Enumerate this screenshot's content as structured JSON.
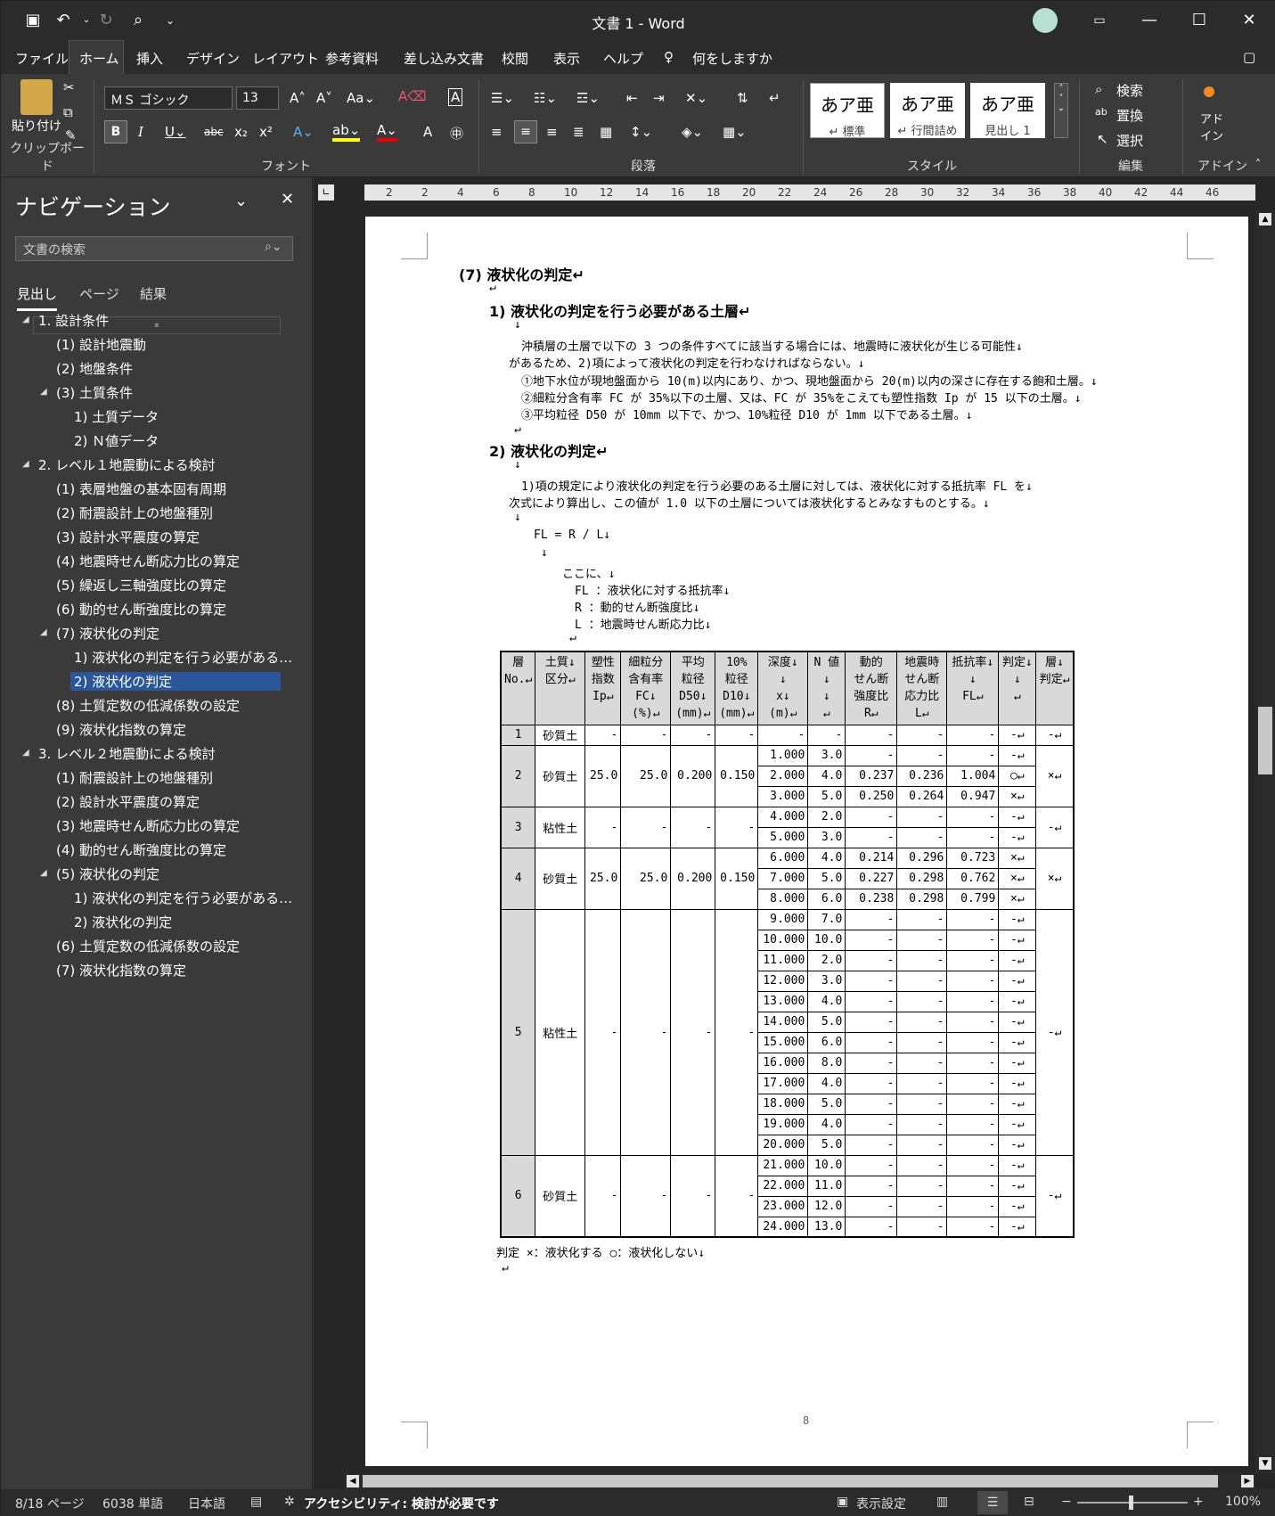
{
  "titlebar": {
    "title": "文書 1  -  Word"
  },
  "menu": [
    "ファイル",
    "ホーム",
    "挿入",
    "デザイン",
    "レイアウト",
    "参考資料",
    "差し込み文書",
    "校閲",
    "表示",
    "ヘルプ",
    "何をしますか"
  ],
  "ribbon": {
    "paste": "貼り付け",
    "font_name": "ＭＳ ゴシック",
    "font_size": "13",
    "groups": {
      "clipboard": "クリップボード",
      "font": "フォント",
      "paragraph": "段落",
      "styles": "スタイル",
      "edit": "編集",
      "addin": "アドイン"
    },
    "styles": [
      {
        "sample": "あア亜",
        "name": "↵ 標準"
      },
      {
        "sample": "あア亜",
        "name": "↵ 行間詰め"
      },
      {
        "sample": "あア亜",
        "name": "見出し 1"
      }
    ],
    "edit": {
      "find": "検索",
      "replace": "置換",
      "select": "選択"
    },
    "addin": "アド\nイン"
  },
  "nav": {
    "title": "ナビゲーション",
    "search_placeholder": "文書の検索",
    "tabs": [
      "見出し",
      "ページ",
      "結果"
    ],
    "items": [
      {
        "label": "1. 設計条件",
        "level": 0,
        "exp": true
      },
      {
        "label": "(1) 設計地震動",
        "level": 1
      },
      {
        "label": "(2) 地盤条件",
        "level": 1
      },
      {
        "label": "(3) 土質条件",
        "level": 1,
        "exp": true
      },
      {
        "label": "1) 土質データ",
        "level": 2
      },
      {
        "label": "2) Ｎ値データ",
        "level": 2
      },
      {
        "label": "2. レベル１地震動による検討",
        "level": 0,
        "exp": true
      },
      {
        "label": "(1) 表層地盤の基本固有周期",
        "level": 1
      },
      {
        "label": "(2) 耐震設計上の地盤種別",
        "level": 1
      },
      {
        "label": "(3) 設計水平震度の算定",
        "level": 1
      },
      {
        "label": "(4) 地震時せん断応力比の算定",
        "level": 1
      },
      {
        "label": "(5) 繰返し三軸強度比の算定",
        "level": 1
      },
      {
        "label": "(6) 動的せん断強度比の算定",
        "level": 1
      },
      {
        "label": "(7) 液状化の判定",
        "level": 1,
        "exp": true
      },
      {
        "label": "1) 液状化の判定を行う必要がある…",
        "level": 2
      },
      {
        "label": "2) 液状化の判定",
        "level": 2,
        "sel": true
      },
      {
        "label": "(8) 土質定数の低減係数の設定",
        "level": 1
      },
      {
        "label": "(9) 液状化指数の算定",
        "level": 1
      },
      {
        "label": "3. レベル２地震動による検討",
        "level": 0,
        "exp": true
      },
      {
        "label": "(1) 耐震設計上の地盤種別",
        "level": 1
      },
      {
        "label": "(2) 設計水平震度の算定",
        "level": 1
      },
      {
        "label": "(3) 地震時せん断応力比の算定",
        "level": 1
      },
      {
        "label": "(4) 動的せん断強度比の算定",
        "level": 1
      },
      {
        "label": "(5) 液状化の判定",
        "level": 1,
        "exp": true
      },
      {
        "label": "1) 液状化の判定を行う必要がある…",
        "level": 2
      },
      {
        "label": "2) 液状化の判定",
        "level": 2
      },
      {
        "label": "(6) 土質定数の低減係数の設定",
        "level": 1
      },
      {
        "label": "(7) 液状化指数の算定",
        "level": 1
      }
    ]
  },
  "ruler": [
    "2",
    "2",
    "4",
    "6",
    "8",
    "10",
    "12",
    "14",
    "16",
    "18",
    "20",
    "22",
    "24",
    "26",
    "28",
    "30",
    "32",
    "34",
    "36",
    "38",
    "40",
    "42",
    "44",
    "46"
  ],
  "doc": {
    "h7": "(7) 液状化の判定↵",
    "h1": "1) 液状化の判定を行う必要がある土層↵",
    "p1": "沖積層の土層で以下の 3 つの条件すべてに該当する場合には、地震時に液状化が生じる可能性↓",
    "p2": "があるため、2)項によって液状化の判定を行わなければならない。↓",
    "c1": "①地下水位が現地盤面から 10(m)以内にあり、かつ、現地盤面から 20(m)以内の深さに存在する飽和土層。↓",
    "c2": "②細粒分含有率 FC が 35%以下の土層、又は、FC が 35%をこえても塑性指数 Ip が 15 以下の土層。↓",
    "c3": "③平均粒径 D50 が 10mm 以下で、かつ、10%粒径 D10 が 1mm 以下である土層。↓",
    "h2": "2) 液状化の判定↵",
    "p3": "1)項の規定により液状化の判定を行う必要のある土層に対しては、液状化に対する抵抗率 FL を↓",
    "p4": "次式により算出し、この値が 1.0 以下の土層については液状化するとみなすものとする。↓",
    "formula": "FL = R / L↓",
    "here": "ここに、↓",
    "d1": "FL ：液状化に対する抵抗率↓",
    "d2": "R  ：動的せん断強度比↓",
    "d3": "L  ：地震時せん断応力比↓",
    "legend": "判定  ×：液状化する  ○：液状化しない↓",
    "pageno": "8"
  },
  "table": {
    "headers": [
      "層\nNo.↵",
      "土質↓\n区分↵",
      "塑性\n指数\nIp↵",
      "細粒分\n含有率\nFC↓\n(%)↵",
      "平均\n粒径\nD50↓\n(mm)↵",
      "10%\n粒径\nD10↓\n(mm)↵",
      "深度↓\n↓\nx↓\n(m)↵",
      "N 値↓\n↓\n↵",
      "動的\nせん断\n強度比\nR↵",
      "地震時\nせん断\n応力比\nL↵",
      "抵抗率↓\n↓\nFL↵",
      "判定↓\n↓\n↵",
      "層↓\n判定↵"
    ],
    "layers": [
      {
        "no": "1",
        "soil": "砂質土",
        "ip": "-",
        "fc": "-",
        "d50": "-",
        "d10": "-",
        "judge": "-↵",
        "rows": [
          [
            "-",
            "-",
            "-",
            "-",
            "-",
            "-↵"
          ]
        ]
      },
      {
        "no": "2",
        "soil": "砂質土",
        "ip": "25.0",
        "fc": "25.0",
        "d50": "0.200",
        "d10": "0.150",
        "judge": "×↵",
        "rows": [
          [
            "1.000",
            "3.0",
            "-",
            "-",
            "-",
            "-↵"
          ],
          [
            "2.000",
            "4.0",
            "0.237",
            "0.236",
            "1.004",
            "○↵"
          ],
          [
            "3.000",
            "5.0",
            "0.250",
            "0.264",
            "0.947",
            "×↵"
          ]
        ]
      },
      {
        "no": "3",
        "soil": "粘性土",
        "ip": "-",
        "fc": "-",
        "d50": "-",
        "d10": "-",
        "judge": "-↵",
        "rows": [
          [
            "4.000",
            "2.0",
            "-",
            "-",
            "-",
            "-↵"
          ],
          [
            "5.000",
            "3.0",
            "-",
            "-",
            "-",
            "-↵"
          ]
        ]
      },
      {
        "no": "4",
        "soil": "砂質土",
        "ip": "25.0",
        "fc": "25.0",
        "d50": "0.200",
        "d10": "0.150",
        "judge": "×↵",
        "rows": [
          [
            "6.000",
            "4.0",
            "0.214",
            "0.296",
            "0.723",
            "×↵"
          ],
          [
            "7.000",
            "5.0",
            "0.227",
            "0.298",
            "0.762",
            "×↵"
          ],
          [
            "8.000",
            "6.0",
            "0.238",
            "0.298",
            "0.799",
            "×↵"
          ]
        ]
      },
      {
        "no": "5",
        "soil": "粘性土",
        "ip": "-",
        "fc": "-",
        "d50": "-",
        "d10": "-",
        "judge": "-↵",
        "rows": [
          [
            "9.000",
            "7.0",
            "-",
            "-",
            "-",
            "-↵"
          ],
          [
            "10.000",
            "10.0",
            "-",
            "-",
            "-",
            "-↵"
          ],
          [
            "11.000",
            "2.0",
            "-",
            "-",
            "-",
            "-↵"
          ],
          [
            "12.000",
            "3.0",
            "-",
            "-",
            "-",
            "-↵"
          ],
          [
            "13.000",
            "4.0",
            "-",
            "-",
            "-",
            "-↵"
          ],
          [
            "14.000",
            "5.0",
            "-",
            "-",
            "-",
            "-↵"
          ],
          [
            "15.000",
            "6.0",
            "-",
            "-",
            "-",
            "-↵"
          ],
          [
            "16.000",
            "8.0",
            "-",
            "-",
            "-",
            "-↵"
          ],
          [
            "17.000",
            "4.0",
            "-",
            "-",
            "-",
            "-↵"
          ],
          [
            "18.000",
            "5.0",
            "-",
            "-",
            "-",
            "-↵"
          ],
          [
            "19.000",
            "4.0",
            "-",
            "-",
            "-",
            "-↵"
          ],
          [
            "20.000",
            "5.0",
            "-",
            "-",
            "-",
            "-↵"
          ]
        ]
      },
      {
        "no": "6",
        "soil": "砂質土",
        "ip": "-",
        "fc": "-",
        "d50": "-",
        "d10": "-",
        "judge": "-↵",
        "rows": [
          [
            "21.000",
            "10.0",
            "-",
            "-",
            "-",
            "-↵"
          ],
          [
            "22.000",
            "11.0",
            "-",
            "-",
            "-",
            "-↵"
          ],
          [
            "23.000",
            "12.0",
            "-",
            "-",
            "-",
            "-↵"
          ],
          [
            "24.000",
            "13.0",
            "-",
            "-",
            "-",
            "-↵"
          ]
        ]
      }
    ]
  },
  "status": {
    "page": "8/18 ページ",
    "words": "6038 単語",
    "lang": "日本語",
    "access": "アクセシビリティ: 検討が必要です",
    "display": "表示設定",
    "zoom": "100%"
  }
}
